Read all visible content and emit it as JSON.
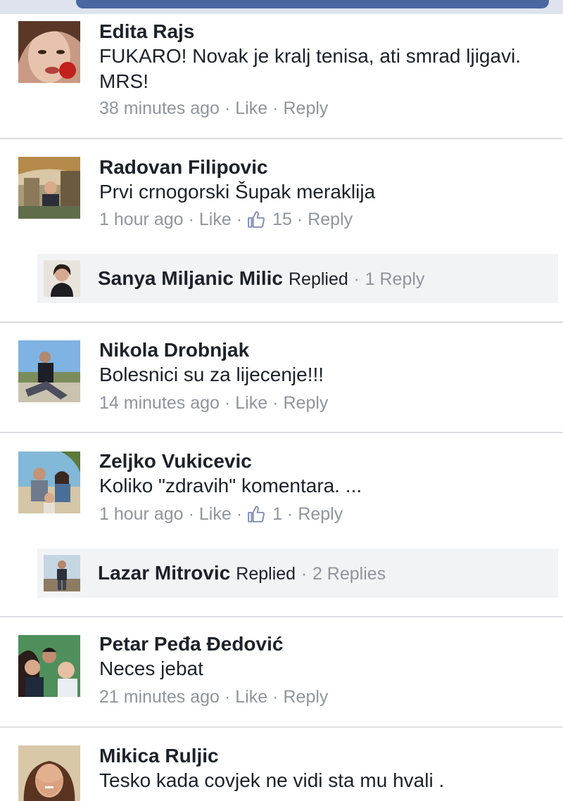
{
  "comments": [
    {
      "name": "Edita Rajs",
      "text": "FUKARO! Novak je kralj tenisa, ati smrad ljigavi. MRS!",
      "time": "38 minutes ago",
      "like": "Like",
      "reply": "Reply"
    },
    {
      "name": "Radovan Filipovic",
      "text": "Prvi crnogorski Šupak meraklija",
      "time": "1 hour ago",
      "like": "Like",
      "reactions": "15",
      "reply": "Reply",
      "replied_by": {
        "name": "Sanya Miljanic Milic",
        "replied_label": "Replied",
        "count_label": "1 Reply"
      }
    },
    {
      "name": "Nikola Drobnjak",
      "text": "Bolesnici su za lijecenje!!!",
      "time": "14 minutes ago",
      "like": "Like",
      "reply": "Reply"
    },
    {
      "name": "Zeljko Vukicevic",
      "text": "Koliko \"zdravih\" komentara. ...",
      "time": "1 hour ago",
      "like": "Like",
      "reactions": "1",
      "reply": "Reply",
      "replied_by": {
        "name": "Lazar Mitrovic",
        "replied_label": "Replied",
        "count_label": "2 Replies"
      }
    },
    {
      "name": "Petar Peđa Đedović",
      "text": "Neces jebat",
      "time": "21 minutes ago",
      "like": "Like",
      "reply": "Reply"
    },
    {
      "name": "Mikica Ruljic",
      "text": "Tesko kada covjek ne vidi sta mu hvali ."
    }
  ],
  "separator": "·",
  "colors": {
    "text": "#1d2129",
    "meta": "#90949c",
    "divider": "#dcdee3",
    "reply_bg": "#f2f3f5",
    "header": "#4b67a1"
  },
  "icons": {
    "like_thumb": "thumbs-up-icon"
  }
}
